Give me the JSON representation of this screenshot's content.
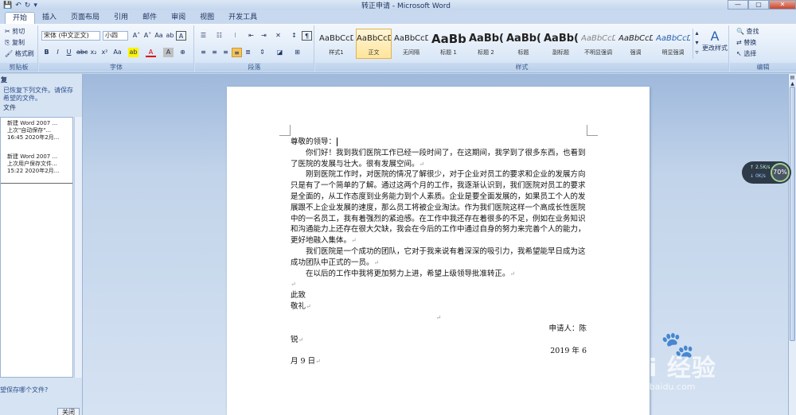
{
  "window": {
    "title": "转正申请 - Microsoft Word",
    "controls": [
      "—",
      "▢",
      "✕"
    ]
  },
  "quick_access": [
    "💾",
    "↶",
    "↻",
    "▾"
  ],
  "tabs": [
    "开始",
    "插入",
    "页面布局",
    "引用",
    "邮件",
    "审阅",
    "视图",
    "开发工具"
  ],
  "ribbon": {
    "clipboard": {
      "cut": "剪切",
      "copy": "复制",
      "format_painter": "格式刷",
      "label": "剪贴板"
    },
    "font": {
      "font_name": "宋体 (中文正文)",
      "font_size": "小四",
      "label": "字体",
      "buttons": [
        "A˄",
        "A˅",
        "Aa",
        "ab",
        "A",
        "B",
        "I",
        "U",
        "abc",
        "x₂",
        "x²",
        "Aa",
        "ab",
        "A",
        "A",
        "⊕"
      ]
    },
    "paragraph": {
      "label": "段落"
    },
    "styles": {
      "label": "样式",
      "items": [
        {
          "sample": "AaBbCcD",
          "name": "样式1"
        },
        {
          "sample": "AaBbCcD",
          "name": "正文"
        },
        {
          "sample": "AaBbCcD",
          "name": "无间隔"
        },
        {
          "sample": "AaBb",
          "name": "标题 1"
        },
        {
          "sample": "AaBb(",
          "name": "标题 2"
        },
        {
          "sample": "AaBb(",
          "name": "标题"
        },
        {
          "sample": "AaBb(",
          "name": "副标题"
        },
        {
          "sample": "AaBbCcD",
          "name": "不明显强调"
        },
        {
          "sample": "AaBbCcD",
          "name": "强调"
        },
        {
          "sample": "AaBbCcD",
          "name": "明显强调"
        }
      ],
      "change_styles": "更改样式"
    },
    "editing": {
      "find": "查找",
      "replace": "替换",
      "select": "选择",
      "label": "编辑"
    }
  },
  "recovery_pane": {
    "title": "复",
    "message": "已恢复下列文件。请保存希望的文件。",
    "section": "文件",
    "files": [
      {
        "name": "新建 Word 2007 ...",
        "status": "上次\"自动保存\"...",
        "time": "16:45 2020年2月..."
      },
      {
        "name": "新建 Word 2007 ...",
        "status": "上次用户保存文件...",
        "time": "15:22 2020年2月..."
      }
    ],
    "question": "望保存哪个文件?",
    "close": "关闭"
  },
  "document": {
    "salutation": "尊敬的领导：",
    "paragraphs": [
      "你们好！我到我们医院工作已经一段时间了，在这期间，我学到了很多东西，也看到了医院的发展与壮大。很有发展空间。",
      "刚到医院工作时，对医院的情况了解很少，对于企业对员工的要求和企业的发展方向只是有了一个简单的了解。通过这两个月的工作，我逐渐认识到，我们医院对员工的要求是全面的，从工作态度到业务能力到个人素质。企业是要全面发展的，如果员工个人的发展跟不上企业发展的速度，那么员工将被企业淘汰。作为我们医院这样一个高成长性医院中的一名员工，我有着强烈的紧迫感。在工作中我还存在着很多的不足，例如在业务知识和沟通能力上还存在很大欠缺，我会在今后的工作中通过自身的努力来完善个人的能力，更好地融入集体。",
      "我们医院是一个成功的团队，它对于我来说有着深深的吸引力，我希望能早日成为这成功团队中正式的一员。",
      "在以后的工作中我将更加努力上进，希望上级领导批准转正。"
    ],
    "closing1": "此致",
    "closing2": "敬礼",
    "applicant": "申请人：陈",
    "applicant_cont": "锐",
    "date": "2019 年 6",
    "date_cont": "月 9 日"
  },
  "network_widget": {
    "up": "2.5K/s",
    "down": "0K/s",
    "percent": "70%"
  },
  "watermark": {
    "brand": "Bai 经验",
    "url": "jingyan.baidu.com"
  }
}
